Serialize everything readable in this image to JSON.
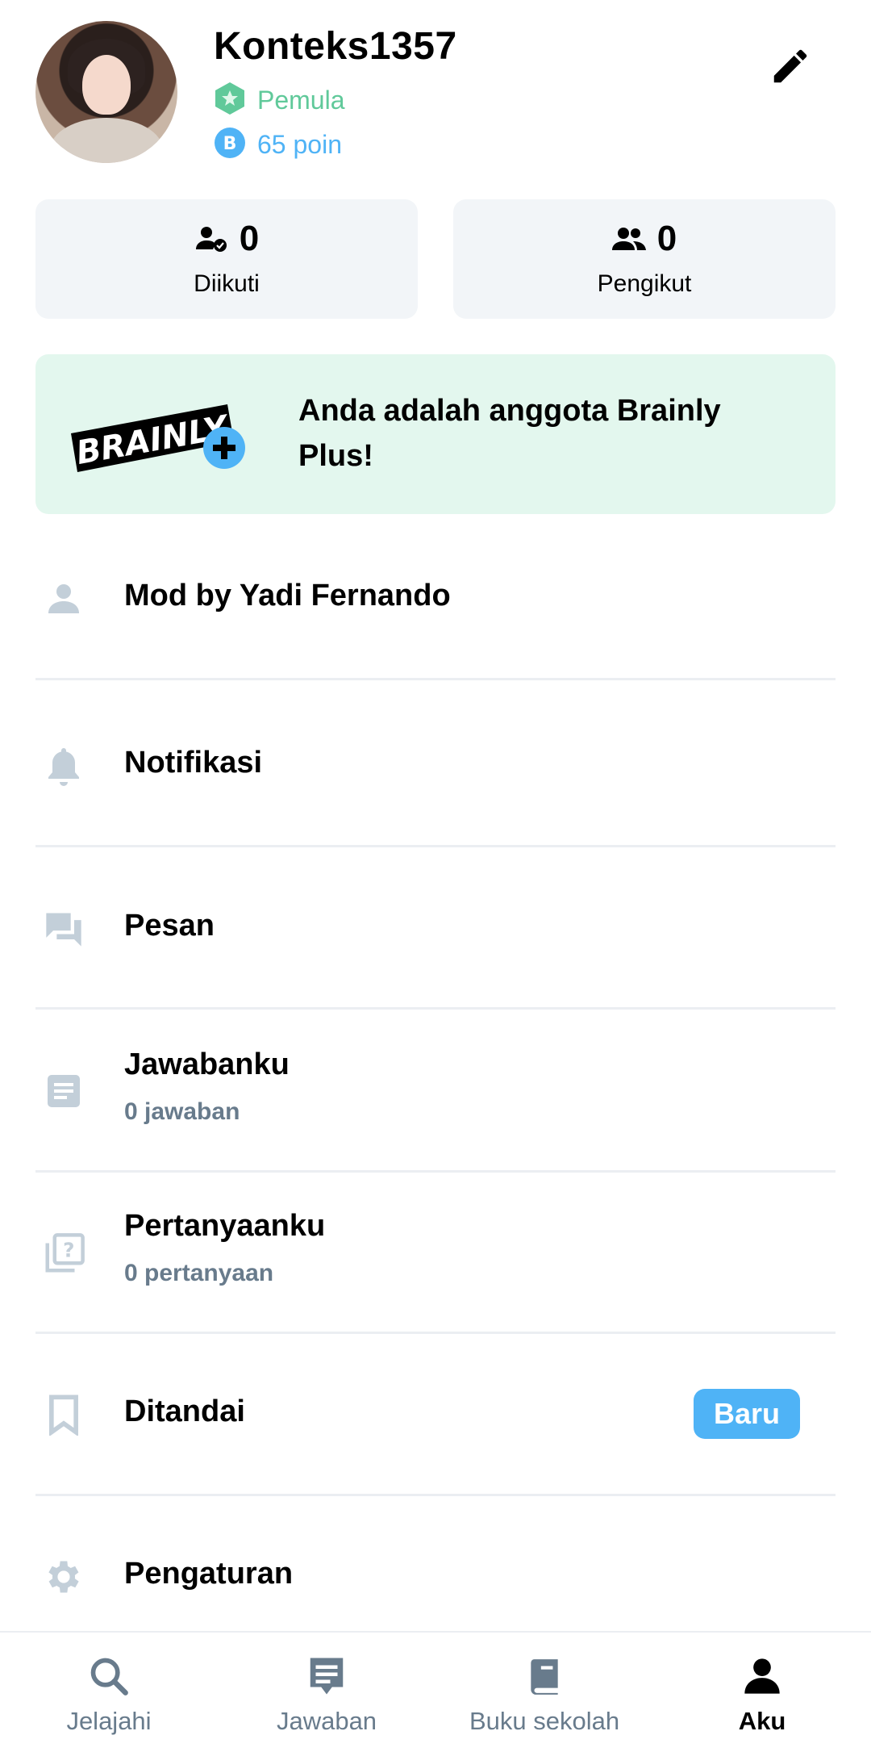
{
  "profile": {
    "username": "Konteks1357",
    "rank": "Pemula",
    "points": "65 poin",
    "edit_icon": "pencil-icon"
  },
  "stats": {
    "following": {
      "count": "0",
      "label": "Diikuti"
    },
    "followers": {
      "count": "0",
      "label": "Pengikut"
    }
  },
  "plus_banner": {
    "logo_text": "BRAINLY",
    "message": "Anda adalah anggota Brainly Plus!"
  },
  "menu": {
    "mod": {
      "label": "Mod by Yadi Fernando",
      "icon": "person-icon"
    },
    "notifications": {
      "label": "Notifikasi",
      "icon": "bell-icon"
    },
    "messages": {
      "label": "Pesan",
      "icon": "chat-icon"
    },
    "answers": {
      "label": "Jawabanku",
      "sub": "0 jawaban",
      "icon": "answers-icon"
    },
    "questions": {
      "label": "Pertanyaanku",
      "sub": "0 pertanyaan",
      "icon": "question-icon"
    },
    "bookmarks": {
      "label": "Ditandai",
      "badge": "Baru",
      "icon": "bookmark-icon"
    },
    "settings": {
      "label": "Pengaturan",
      "icon": "gear-icon"
    }
  },
  "nav": {
    "explore": "Jelajahi",
    "answers": "Jawaban",
    "textbooks": "Buku sekolah",
    "me": "Aku",
    "active": "me"
  },
  "colors": {
    "accent_blue": "#4fb3f6",
    "rank_green": "#60c99a",
    "plus_bg": "#e3f7ee",
    "muted_icon": "#c3cfd9"
  }
}
